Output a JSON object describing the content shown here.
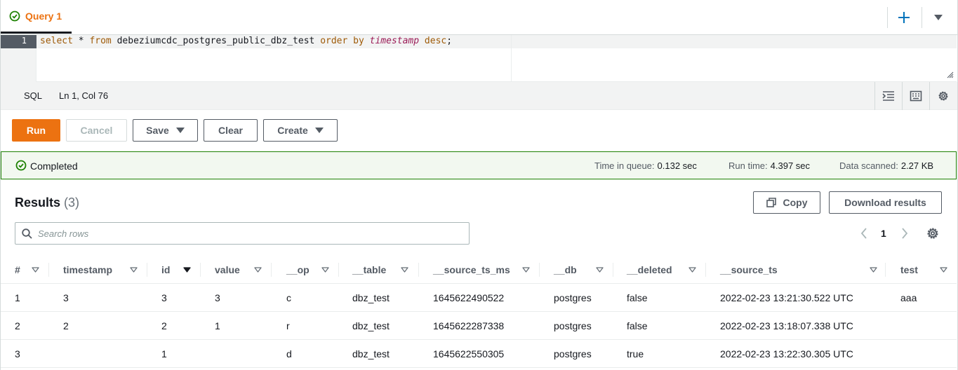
{
  "tab": {
    "label": "Query 1"
  },
  "editor": {
    "line_number": "1",
    "code_tokens": [
      {
        "text": "select",
        "style": "kw"
      },
      {
        "text": " * ",
        "style": "plain"
      },
      {
        "text": "from",
        "style": "kw"
      },
      {
        "text": " debeziumcdc_postgres_public_dbz_test ",
        "style": "plain"
      },
      {
        "text": "order",
        "style": "kw"
      },
      {
        "text": " ",
        "style": "plain"
      },
      {
        "text": "by",
        "style": "kw"
      },
      {
        "text": " ",
        "style": "plain"
      },
      {
        "text": "timestamp",
        "style": "fn"
      },
      {
        "text": " ",
        "style": "plain"
      },
      {
        "text": "desc",
        "style": "kw"
      },
      {
        "text": ";",
        "style": "plain"
      }
    ]
  },
  "statusbar": {
    "language": "SQL",
    "cursor": "Ln 1, Col 76"
  },
  "actions": {
    "run": "Run",
    "cancel": "Cancel",
    "save": "Save",
    "clear": "Clear",
    "create": "Create"
  },
  "execution": {
    "status": "Completed",
    "time_in_queue_label": "Time in queue:",
    "time_in_queue": "0.132 sec",
    "run_time_label": "Run time:",
    "run_time": "4.397 sec",
    "data_scanned_label": "Data scanned:",
    "data_scanned": "2.27 KB"
  },
  "results": {
    "title": "Results",
    "count": "(3)",
    "copy": "Copy",
    "download": "Download results",
    "search_placeholder": "Search rows",
    "page": "1",
    "columns": [
      "#",
      "timestamp",
      "id",
      "value",
      "__op",
      "__table",
      "__source_ts_ms",
      "__db",
      "__deleted",
      "__source_ts",
      "test"
    ],
    "rows": [
      [
        "1",
        "3",
        "3",
        "3",
        "c",
        "dbz_test",
        "1645622490522",
        "postgres",
        "false",
        "2022-02-23 13:21:30.522 UTC",
        "aaa"
      ],
      [
        "2",
        "2",
        "2",
        "1",
        "r",
        "dbz_test",
        "1645622287338",
        "postgres",
        "false",
        "2022-02-23 13:18:07.338 UTC",
        ""
      ],
      [
        "3",
        "",
        "1",
        "",
        "d",
        "dbz_test",
        "1645622550305",
        "postgres",
        "true",
        "2022-02-23 13:22:30.305 UTC",
        ""
      ]
    ]
  },
  "colors": {
    "accent": "#ec7211",
    "success": "#1d8102",
    "success_bg": "#f2f8f0"
  }
}
